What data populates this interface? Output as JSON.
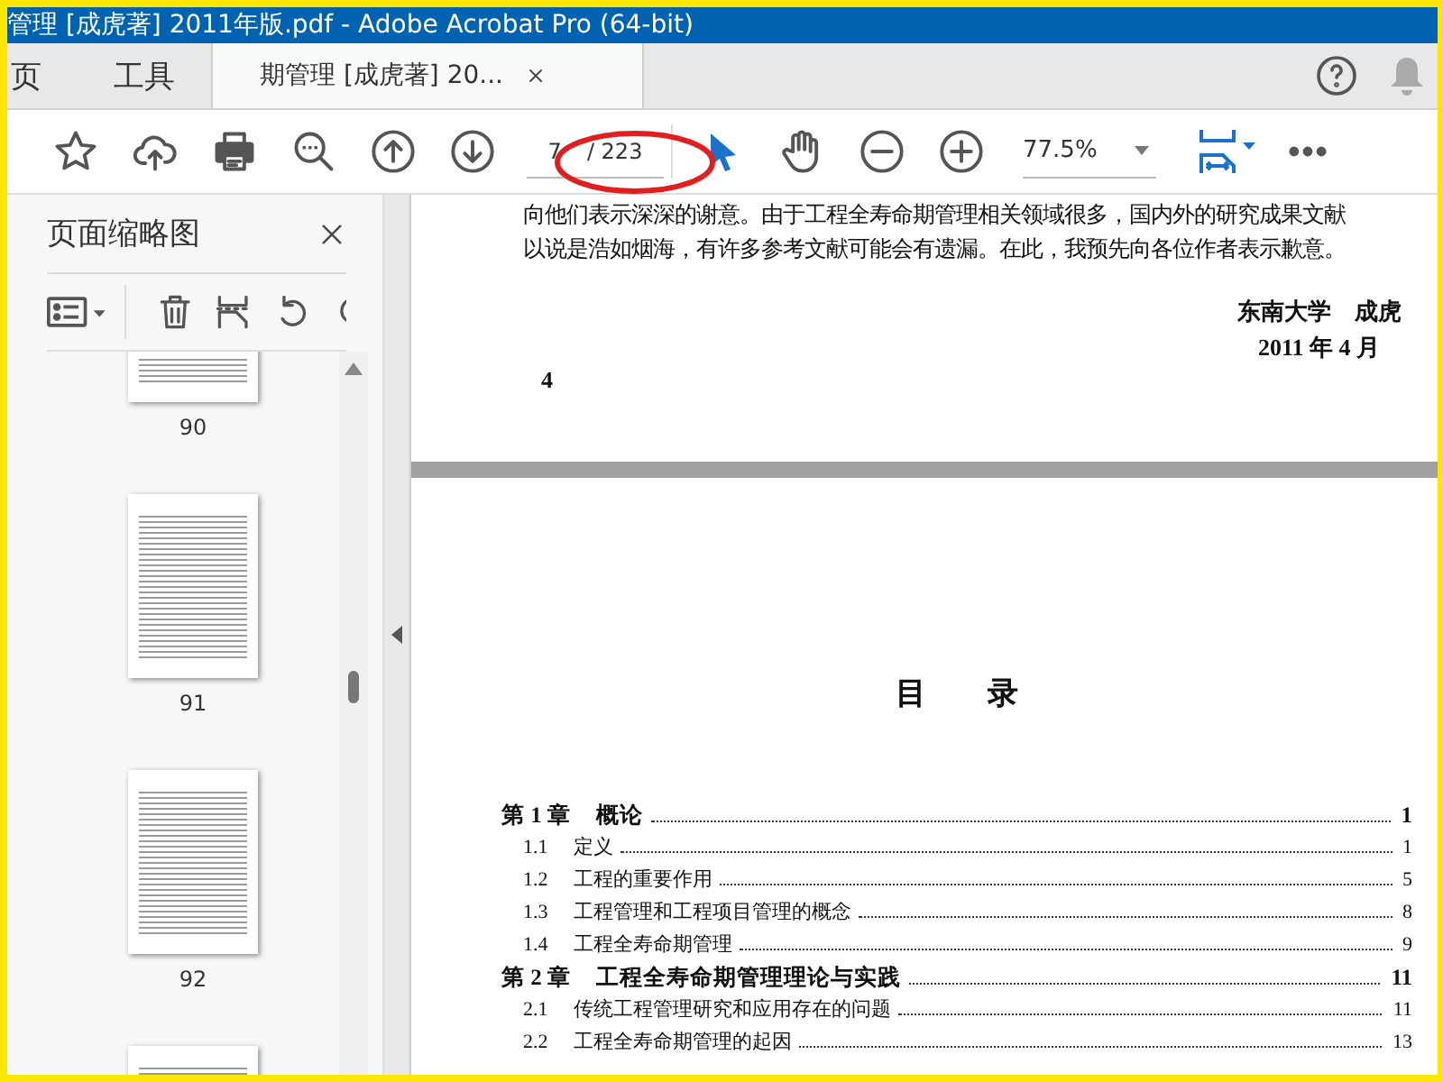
{
  "window": {
    "title": "管理 [成虎著] 2011年版.pdf - Adobe Acrobat Pro (64-bit)"
  },
  "tabs": [
    {
      "label": "页",
      "selected": false
    },
    {
      "label": "工具",
      "selected": false
    },
    {
      "label": "期管理 [成虎著] 20...",
      "selected": true
    }
  ],
  "toolbar": {
    "page_number": "7",
    "page_total": "/ 223",
    "zoom": "77.5%"
  },
  "panel": {
    "title": "页面缩略图",
    "thumbnails": [
      "90",
      "91",
      "92"
    ]
  },
  "document": {
    "lines": [
      "向他们表示深深的谢意。由于工程全寿命期管理相关领域很多，国内外的研究成果文献",
      "以说是浩如烟海，有许多参考文献可能会有遗漏。在此，我预先向各位作者表示歉意。"
    ],
    "signature": "东南大学　成虎",
    "date": "2011 年 4 月",
    "page_number": "4",
    "heading": "目　　录",
    "toc": [
      {
        "kind": "chapter",
        "number": "第 1 章",
        "title": "概论",
        "page": "1"
      },
      {
        "kind": "section",
        "number": "1.1",
        "title": "定义",
        "page": "1"
      },
      {
        "kind": "section",
        "number": "1.2",
        "title": "工程的重要作用",
        "page": "5"
      },
      {
        "kind": "section",
        "number": "1.3",
        "title": "工程管理和工程项目管理的概念",
        "page": "8"
      },
      {
        "kind": "section",
        "number": "1.4",
        "title": "工程全寿命期管理",
        "page": "9"
      },
      {
        "kind": "chapter",
        "number": "第 2 章",
        "title": "工程全寿命期管理理论与实践",
        "page": "11"
      },
      {
        "kind": "section",
        "number": "2.1",
        "title": "传统工程管理研究和应用存在的问题",
        "page": "11"
      },
      {
        "kind": "section",
        "number": "2.2",
        "title": "工程全寿命期管理的起因",
        "page": "13"
      }
    ]
  }
}
